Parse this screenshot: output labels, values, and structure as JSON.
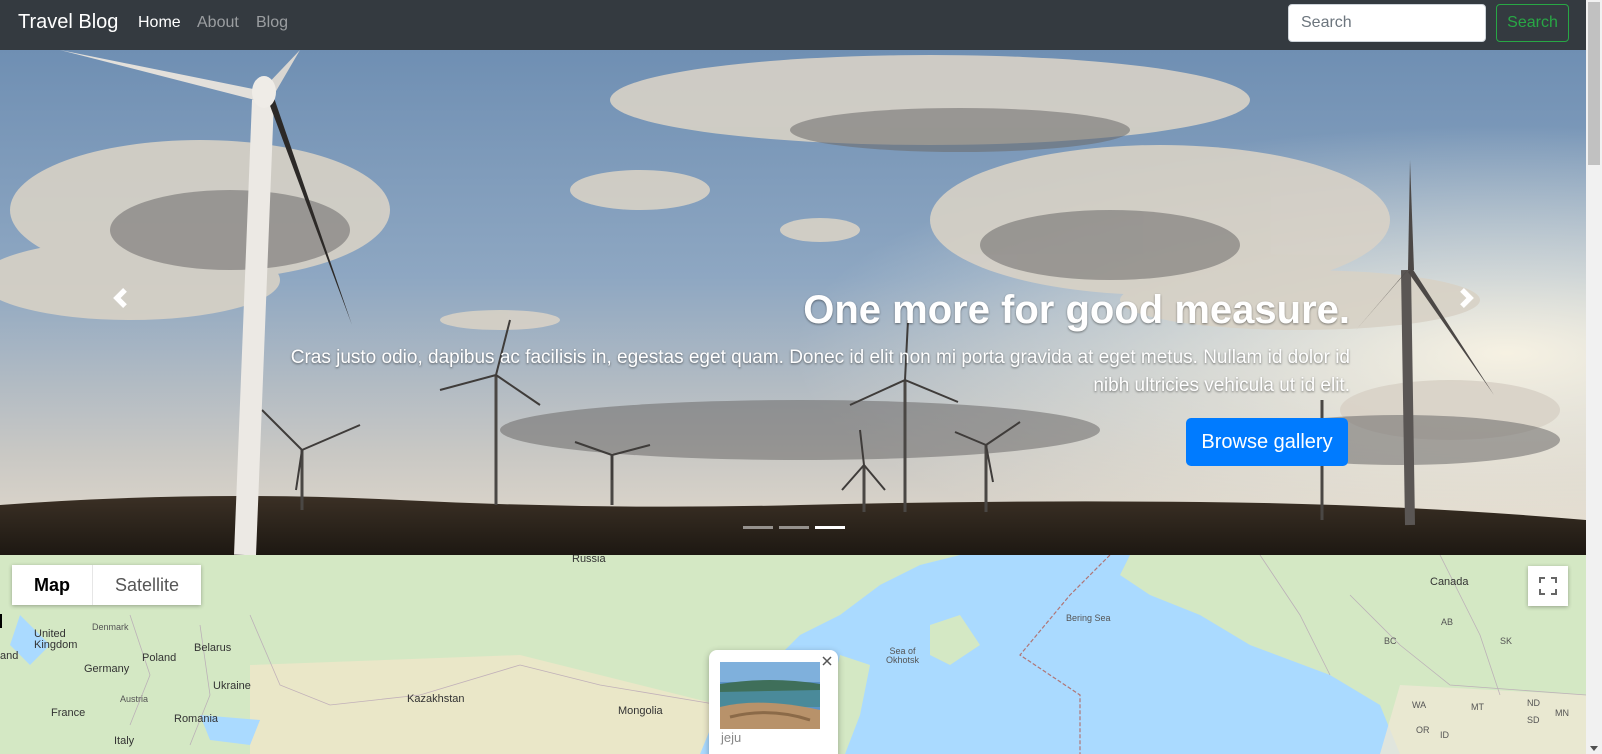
{
  "navbar": {
    "brand": "Travel Blog",
    "links": [
      {
        "label": "Home",
        "active": true
      },
      {
        "label": "About",
        "active": false
      },
      {
        "label": "Blog",
        "active": false
      }
    ],
    "search_placeholder": "Search",
    "search_button": "Search"
  },
  "carousel": {
    "caption_title": "One more for good measure.",
    "caption_text": "Cras justo odio, dapibus ac facilisis in, egestas eget quam. Donec id elit non mi porta gravida at eget metus. Nullam id dolor id nibh ultricies vehicula ut id elit.",
    "button_label": "Browse gallery",
    "slide_count": 3,
    "active_slide": 3,
    "prev_icon": "chevron-left-icon",
    "next_icon": "chevron-right-icon"
  },
  "map": {
    "map_types": [
      "Map",
      "Satellite"
    ],
    "active_map_type": "Map",
    "fullscreen_icon": "fullscreen-icon",
    "labels": {
      "russia": "Russia",
      "canada": "Canada",
      "united_kingdom": "United\nKingdom",
      "denmark": "Denmark",
      "poland": "Poland",
      "belarus": "Belarus",
      "germany": "Germany",
      "ukraine": "Ukraine",
      "austria": "Austria",
      "france": "France",
      "romania": "Romania",
      "kazakhstan": "Kazakhstan",
      "mongolia": "Mongolia",
      "italy": "Italy",
      "land": "and",
      "sea_of_okhotsk": "Sea of\nOkhotsk",
      "bering_sea": "Bering Sea",
      "bc": "BC",
      "ab": "AB",
      "sk": "SK",
      "wa": "WA",
      "mt": "MT",
      "nd": "ND",
      "sd": "SD",
      "mn": "MN",
      "or": "OR",
      "id": "ID"
    },
    "info_window": {
      "label": "jeju",
      "close_icon": "close-icon"
    }
  },
  "colors": {
    "navbar_bg": "#343a40",
    "primary": "#007bff",
    "success": "#28a745",
    "map_water": "#aadaff",
    "map_land": "#d4e8c4"
  }
}
